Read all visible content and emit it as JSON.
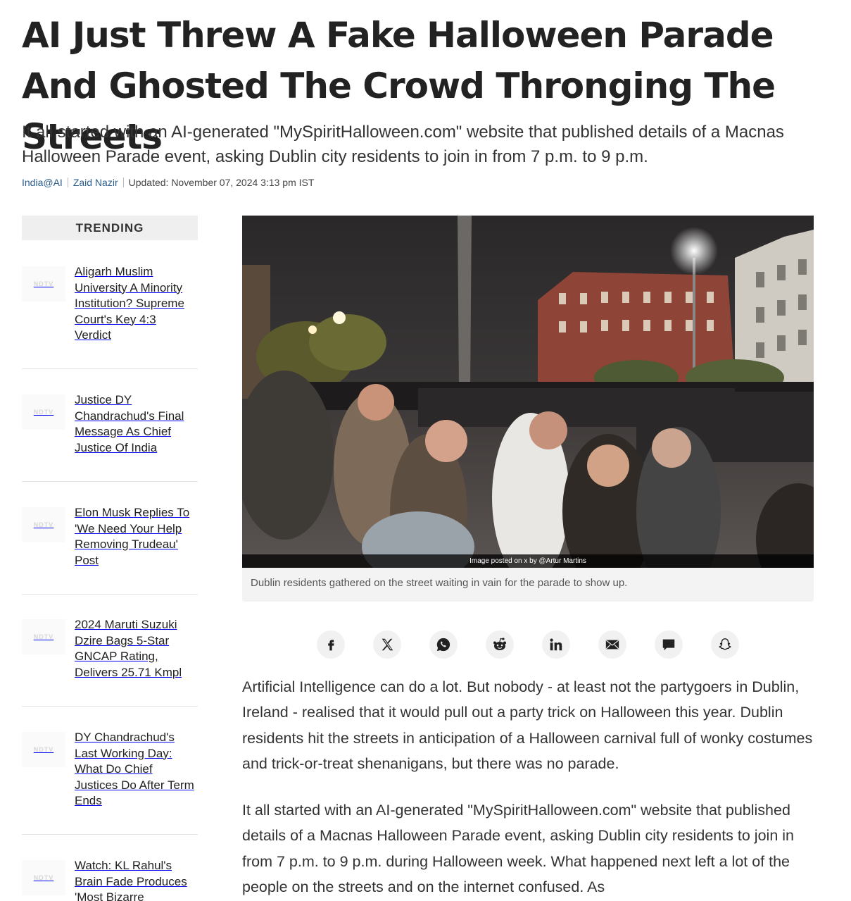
{
  "article": {
    "headline": "AI Just Threw A Fake Halloween Parade And Ghosted The Crowd Thronging The Streets",
    "summary": "It all started with an AI-generated \"MySpiritHalloween.com\" website that published details of a Macnas Halloween Parade event, asking Dublin city residents to join in from 7 p.m. to 9 p.m.",
    "byline": {
      "section": "India@AI",
      "author": "Zaid Nazir",
      "updated": "Updated: November 07, 2024 3:13 pm IST"
    },
    "image": {
      "credit": "Image posted on x by @Artur Martins",
      "caption": "Dublin residents gathered on the street waiting in vain for the parade to show up."
    },
    "paragraphs": [
      "Artificial Intelligence can do a lot. But nobody - at least not the partygoers in Dublin, Ireland - realised that it would pull out a party trick on Halloween this year. Dublin residents hit the streets in anticipation of a Halloween carnival full of wonky costumes and trick-or-treat shenanigans, but there was no parade.",
      "It all started with an AI-generated \"MySpiritHalloween.com\" website that published details of a Macnas Halloween Parade event, asking Dublin city residents to join in from 7 p.m. to 9 p.m. during Halloween week. What happened next left a lot of the people on the streets and on the internet confused. As"
    ]
  },
  "trending": {
    "heading": "TRENDING",
    "thumb_label": "NDTV",
    "items": [
      {
        "title": "Aligarh Muslim University A Minority Institution? Supreme Court's Key 4:3 Verdict"
      },
      {
        "title": "Justice DY Chandrachud's Final Message As Chief Justice Of India"
      },
      {
        "title": "Elon Musk Replies To 'We Need Your Help Removing Trudeau' Post"
      },
      {
        "title": "2024 Maruti Suzuki Dzire Bags 5-Star GNCAP Rating, Delivers 25.71 Kmpl"
      },
      {
        "title": "DY Chandrachud's Last Working Day: What Do Chief Justices Do After Term Ends"
      },
      {
        "title": "Watch: KL Rahul's Brain Fade Produces 'Most Bizarre"
      }
    ]
  },
  "share": {
    "buttons": [
      {
        "icon": "facebook-icon"
      },
      {
        "icon": "x-twitter-icon"
      },
      {
        "icon": "whatsapp-icon"
      },
      {
        "icon": "reddit-icon"
      },
      {
        "icon": "linkedin-icon"
      },
      {
        "icon": "email-icon"
      },
      {
        "icon": "comment-icon"
      },
      {
        "icon": "snapchat-icon"
      }
    ]
  },
  "colors": {
    "link": "#2b5d8c",
    "text": "#222222",
    "panel": "#efefef"
  }
}
